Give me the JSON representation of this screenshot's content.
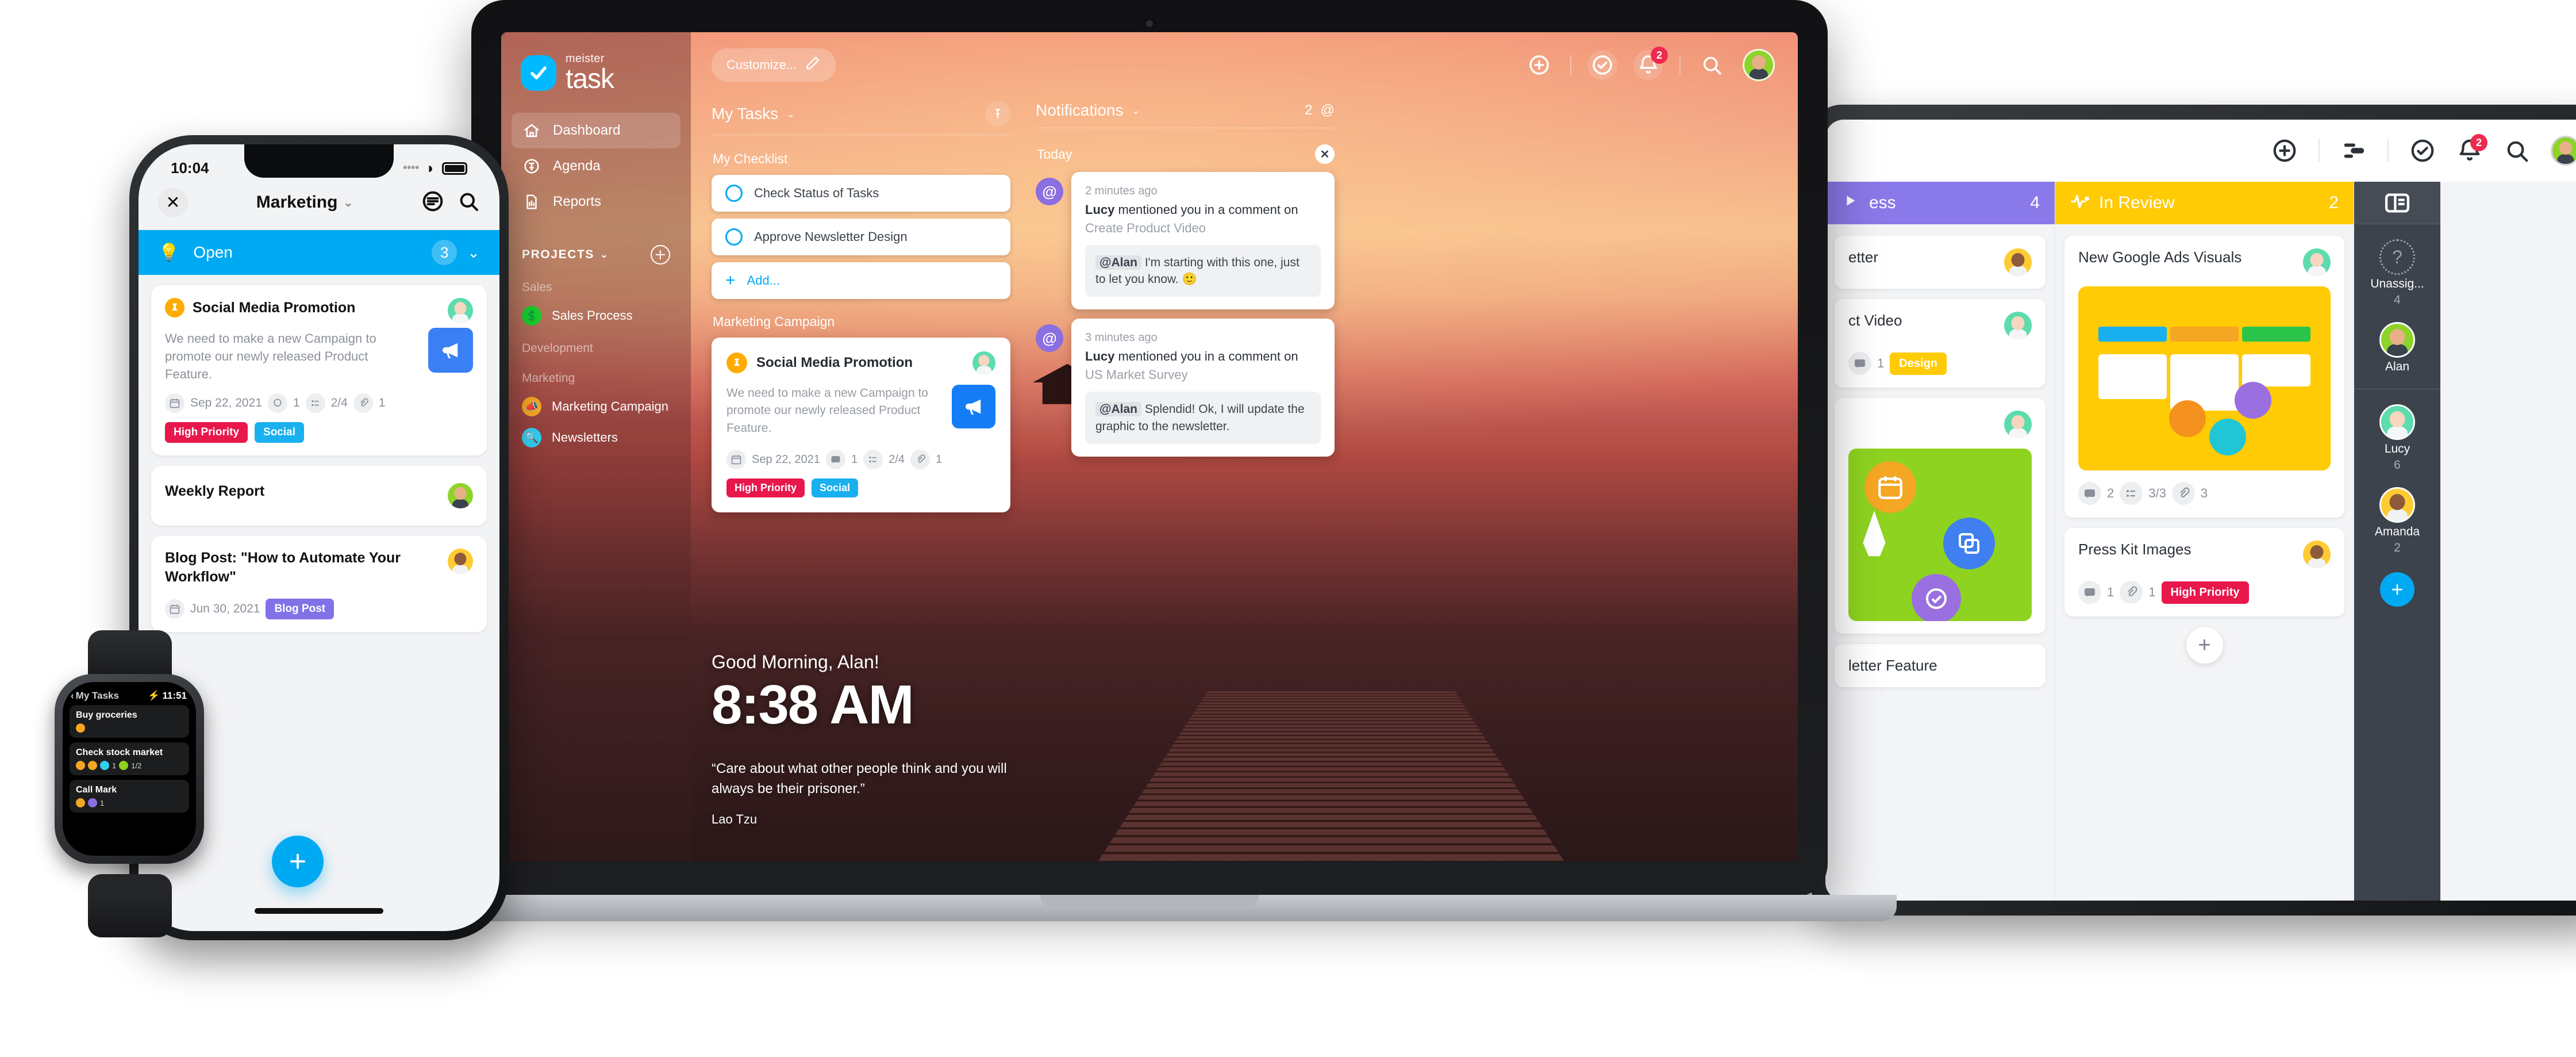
{
  "brand": {
    "top": "meister",
    "bottom": "task"
  },
  "laptop": {
    "sidebar": {
      "nav": [
        {
          "label": "Dashboard",
          "icon": "home-icon",
          "active": true
        },
        {
          "label": "Agenda",
          "icon": "pin-icon",
          "active": false
        },
        {
          "label": "Reports",
          "icon": "report-icon",
          "active": false
        }
      ],
      "projects_label": "PROJECTS",
      "groups": [
        {
          "name": "Sales",
          "projects": [
            {
              "label": "Sales Process",
              "glyph": "💲",
              "color": "#19cf2b"
            }
          ]
        },
        {
          "name": "Development",
          "projects": []
        },
        {
          "name": "Marketing",
          "projects": [
            {
              "label": "Marketing Campaign",
              "glyph": "📣",
              "color": "#f5a623"
            },
            {
              "label": "Newsletters",
              "glyph": "🔍",
              "color": "#34cdf0"
            }
          ]
        }
      ]
    },
    "topbar": {
      "customize_label": "Customize...",
      "notification_count": "2",
      "icons": [
        "plus-circle-icon",
        "check-circle-icon",
        "bell-icon",
        "search-icon",
        "avatar"
      ]
    },
    "columns": {
      "tasks": {
        "title": "My Tasks",
        "checklist_title": "My Checklist",
        "items": [
          {
            "label": "Check Status of Tasks"
          },
          {
            "label": "Approve Newsletter Design"
          }
        ],
        "add_label": "Add...",
        "project_label": "Marketing Campaign",
        "card": {
          "title": "Social Media Promotion",
          "description": "We need to make a new Campaign to promote our newly released Product Feature.",
          "date": "Sep 22, 2021",
          "comments": "1",
          "checklist": "2/4",
          "attachments": "1",
          "tags": [
            {
              "label": "High Priority",
              "color": "#e8174c"
            },
            {
              "label": "Social",
              "color": "#19b0ef"
            }
          ]
        }
      },
      "notifications": {
        "title": "Notifications",
        "count": "2",
        "group_label": "Today",
        "items": [
          {
            "ago": "2 minutes ago",
            "actor": "Lucy",
            "action": "mentioned you in a comment on",
            "object": "Create Product Video",
            "mention": "@Alan",
            "quote": "I'm starting with this one, just to let you know. 🙂"
          },
          {
            "ago": "3 minutes ago",
            "actor": "Lucy",
            "action": "mentioned you in a comment on",
            "object": "US Market Survey",
            "mention": "@Alan",
            "quote": "Splendid! Ok, I will update the graphic to the newsletter."
          }
        ]
      }
    },
    "greeting": {
      "hello": "Good Morning, Alan!",
      "clock": "8:38 AM",
      "quote": "“Care about what other people think and you will always be their prisoner.”",
      "author": "Lao Tzu"
    }
  },
  "phone": {
    "status_time": "10:04",
    "nav_title": "Marketing",
    "section": {
      "label": "Open",
      "count": "3"
    },
    "cards": [
      {
        "title": "Social Media Promotion",
        "description": "We need to make a new Campaign to promote our newly released Product Feature.",
        "date": "Sep 22, 2021",
        "comments": "1",
        "checklist": "2/4",
        "attachments": "1",
        "tags": [
          {
            "label": "High Priority",
            "color": "#e8174c"
          },
          {
            "label": "Social",
            "color": "#19b0ef"
          }
        ],
        "avatar": "lucy"
      },
      {
        "title": "Weekly Report",
        "avatar": "alan"
      },
      {
        "title": "Blog Post: \"How to Automate Your Workflow\"",
        "date": "Jun 30, 2021",
        "tags": [
          {
            "label": "Blog Post",
            "color": "#8172e8"
          }
        ],
        "avatar": "amanda"
      }
    ],
    "add_label": "+"
  },
  "watch": {
    "back_label": "My Tasks",
    "time": "11:51",
    "tasks": [
      {
        "title": "Buy groceries",
        "dots": [
          "#f5a623"
        ],
        "meta": ""
      },
      {
        "title": "Check stock market",
        "dots": [
          "#f5a623",
          "#f5a623",
          "#34cdf0"
        ],
        "meta": "1",
        "meta2": "1/2",
        "dot2": "#8ed320"
      },
      {
        "title": "Call Mark",
        "dots": [
          "#f5a623",
          "#8b6ee0"
        ],
        "meta": "1"
      }
    ]
  },
  "tablet": {
    "toolbar_icons": [
      "plus-circle-icon",
      "filter-icon",
      "check-circle-icon",
      "bell-icon",
      "search-icon",
      "avatar"
    ],
    "notification_count": "2",
    "columns": [
      {
        "title": "In Progress",
        "title_visible": "ess",
        "count": "4",
        "color": "#8a79e8",
        "icon": "play-icon",
        "cards": [
          {
            "title": "Newsletter",
            "title_visible": "etter",
            "avatar": "amanda"
          },
          {
            "title": "Create Product Video",
            "title_visible": "ct Video",
            "comments": "1",
            "tags": [
              {
                "label": "Design",
                "color": "#ffcb05"
              }
            ],
            "avatar": "lucy"
          },
          {
            "title": "Newsletter Feature",
            "title_visible": "letter Feature",
            "avatar": "lucy",
            "thumb": "green"
          }
        ]
      },
      {
        "title": "In Review",
        "count": "2",
        "color": "#ffcb05",
        "icon": "pulse-icon",
        "cards": [
          {
            "title": "New Google Ads Visuals",
            "thumb": "yellow",
            "comments": "2",
            "checklist": "3/3",
            "attachments": "3",
            "avatar": "lucy"
          },
          {
            "title": "Press Kit Images",
            "comments": "1",
            "attachments": "1",
            "tags": [
              {
                "label": "High Priority",
                "color": "#e8174c"
              }
            ],
            "avatar": "amanda"
          }
        ],
        "add_label": "+"
      }
    ],
    "rail": {
      "members": [
        {
          "name": "Unassig...",
          "count": "4",
          "type": "unassigned"
        },
        {
          "name": "Alan",
          "count": "",
          "type": "alan"
        },
        {
          "name": "Lucy",
          "count": "6",
          "type": "lucy"
        },
        {
          "name": "Amanda",
          "count": "2",
          "type": "amanda"
        }
      ],
      "add_label": "+"
    }
  }
}
